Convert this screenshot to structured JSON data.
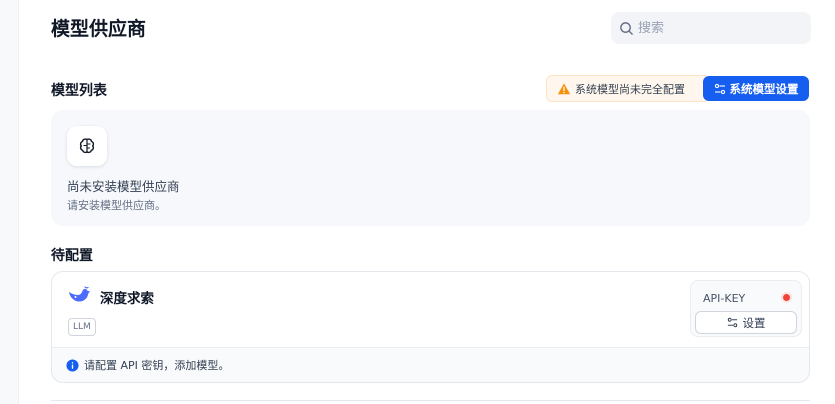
{
  "header": {
    "title": "模型供应商",
    "search_placeholder": "搜索"
  },
  "model_list": {
    "title": "模型列表",
    "warning_text": "系统模型尚未完全配置",
    "settings_button_label": "系统模型设置",
    "empty": {
      "title": "尚未安装模型供应商",
      "subtitle": "请安装模型供应商。"
    }
  },
  "pending": {
    "title": "待配置",
    "provider": {
      "name": "深度求索",
      "tag": "LLM",
      "api_key_label": "API-KEY",
      "status": "not-configured",
      "setup_button_label": "设置",
      "hint": "请配置 API 密钥，添加模型。"
    }
  },
  "colors": {
    "accent": "#155EEF",
    "warning": "#F79009",
    "error_dot": "#F04438",
    "brand_whale": "#4D6BFE"
  },
  "icons": [
    "search-icon",
    "warning-icon",
    "sliders-icon",
    "brain-icon",
    "deepseek-whale-icon",
    "info-icon"
  ]
}
